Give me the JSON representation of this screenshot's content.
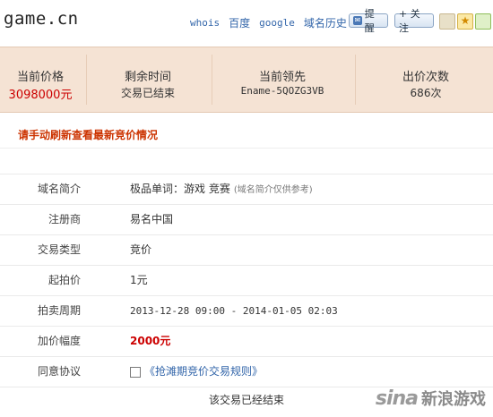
{
  "header": {
    "domain": "game.cn",
    "links": [
      "whois",
      "百度",
      "google",
      "域名历史"
    ],
    "remind_button": "提醒",
    "follow_button": "+ 关注"
  },
  "stats": [
    {
      "label": "当前价格",
      "value": "3098000元"
    },
    {
      "label": "剩余时间",
      "value": "交易已结束"
    },
    {
      "label": "当前领先",
      "value": "Ename-5QOZG3VB"
    },
    {
      "label": "出价次数",
      "value": "686次"
    }
  ],
  "refresh_notice": "请手动刷新查看最新竞价情况",
  "info": {
    "rows": [
      {
        "key": "域名简介",
        "value": "极品单词：游戏 竞赛",
        "note": "(域名简介仅供参考)"
      },
      {
        "key": "注册商",
        "value": "易名中国"
      },
      {
        "key": "交易类型",
        "value": "竞价"
      },
      {
        "key": "起拍价",
        "value": "1元"
      },
      {
        "key": "拍卖周期",
        "value": "2013-12-28 09:00 - 2014-01-05 02:03"
      },
      {
        "key": "加价幅度",
        "value": "2000元"
      },
      {
        "key": "同意协议",
        "value": "《抢滩期竞价交易规则》"
      }
    ]
  },
  "ended_text": "该交易已经结束",
  "watermark": {
    "logo": "sina",
    "text": "新浪游戏"
  },
  "colors": {
    "stats_bg": "#f5e3d4",
    "price_red": "#cc0000",
    "link_blue": "#3366aa"
  }
}
